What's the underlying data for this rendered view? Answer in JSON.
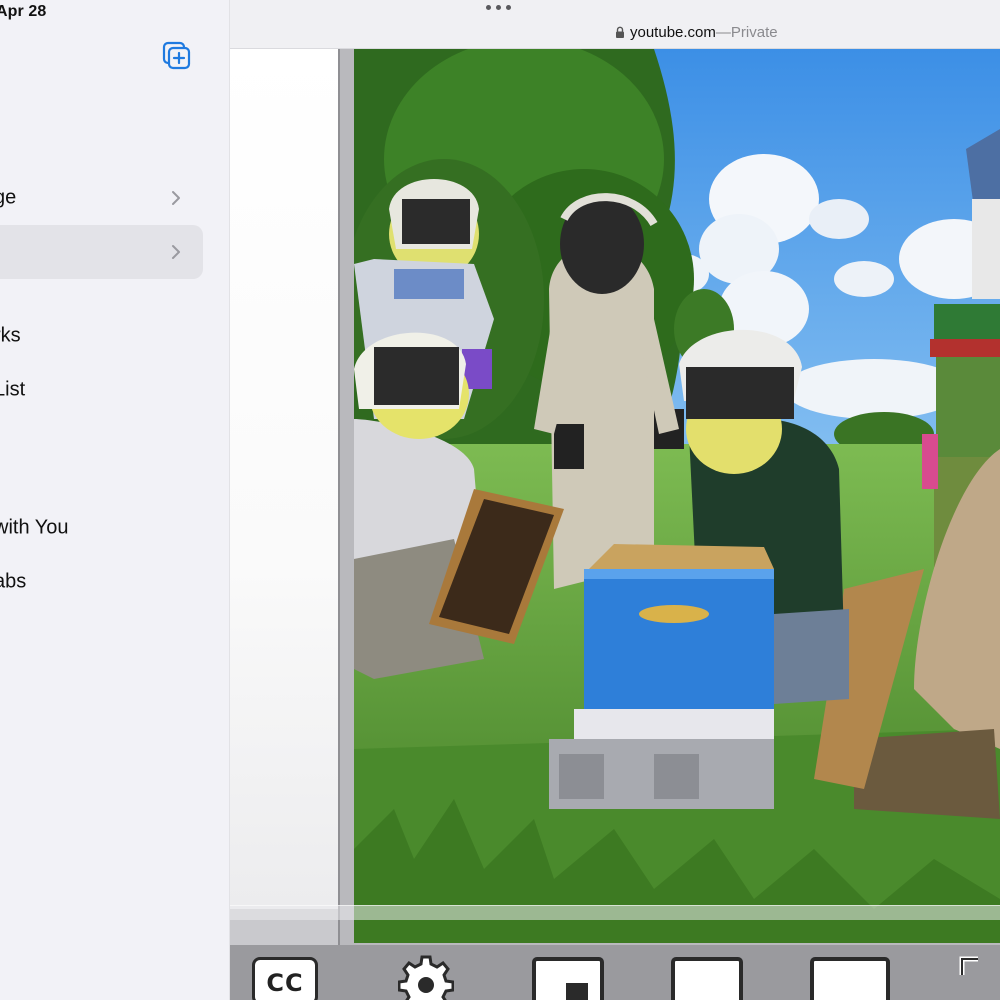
{
  "status_bar": {
    "date": "Apr 28"
  },
  "sidebar": {
    "items": [
      {
        "label": "ge",
        "chevron": true,
        "selected": false
      },
      {
        "label": "",
        "chevron": true,
        "selected": true
      },
      {
        "label": "rks",
        "chevron": false,
        "selected": false
      },
      {
        "label": "List",
        "chevron": false,
        "selected": false
      },
      {
        "label": "with You",
        "chevron": false,
        "selected": false
      },
      {
        "label": "abs",
        "chevron": false,
        "selected": false
      }
    ],
    "new_tab_group_icon": "square-on-square-plus-icon"
  },
  "browser": {
    "domain": "youtube.com",
    "separator": " — ",
    "mode": "Private",
    "more_icon": "ellipsis-icon",
    "lock_icon": "lock-icon"
  },
  "player": {
    "video_subject": "beekeepers-inspecting-hive",
    "controls": [
      {
        "name": "closed-captions",
        "label": "CC"
      },
      {
        "name": "settings",
        "icon": "gear-icon"
      },
      {
        "name": "picture-in-picture",
        "icon": "miniplayer-icon"
      },
      {
        "name": "theater-mode",
        "icon": "theater-icon"
      },
      {
        "name": "fullscreen",
        "icon": "fullscreen-icon"
      },
      {
        "name": "expand",
        "icon": "expand-corners-icon"
      }
    ]
  },
  "colors": {
    "sidebar_bg": "#f2f2f7",
    "accent": "#1f7ae0",
    "hive_blue": "#2e7fd9"
  }
}
